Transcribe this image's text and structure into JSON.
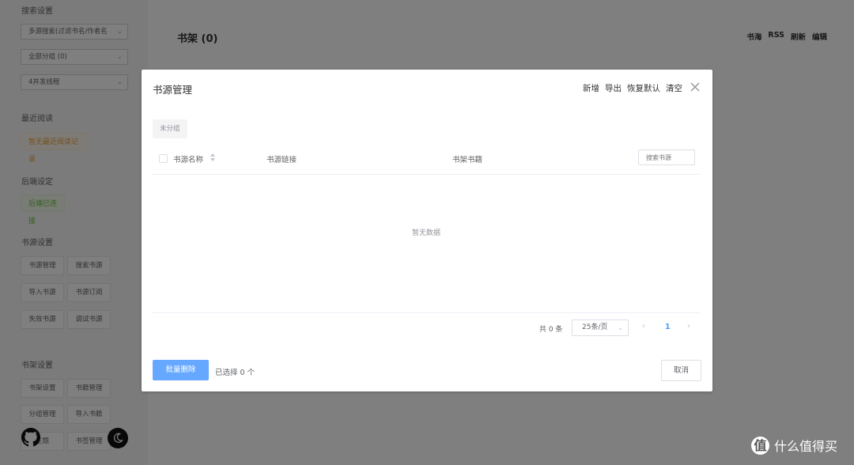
{
  "sidebar": {
    "search_section_title": "搜索设置",
    "search_select_value": "多源搜索(过滤书名/作者名",
    "group_select_value": "全部分组 (0)",
    "concurrency_select_value": "4并发线程",
    "recent_section_title": "最近阅读",
    "recent_tag": "暂无最近阅读记录",
    "backend_section_title": "后端设定",
    "backend_tag": "后端已连接",
    "source_section_title": "书源设置",
    "source_buttons": [
      "书源管理",
      "搜索书源",
      "导入书源",
      "书源订阅",
      "失效书源",
      "调试书源"
    ],
    "shelf_section_title": "书架设置",
    "shelf_buttons": [
      "书架设置",
      "书籍管理",
      "分组管理",
      "导入书籍",
      "主题",
      "书签管理"
    ]
  },
  "main": {
    "title": "书架 (0)",
    "top_links": [
      "书海",
      "RSS",
      "刷新",
      "编辑"
    ]
  },
  "dialog": {
    "title": "书源管理",
    "actions": [
      "新增",
      "导出",
      "恢复默认",
      "清空"
    ],
    "group_tab": "未分组",
    "columns": {
      "name": "书源名称",
      "url": "书源链接",
      "shelf": "书架书籍"
    },
    "search_placeholder": "搜索书源",
    "empty_text": "暂无数据",
    "pagination": {
      "total": "共 0 条",
      "page_size": "25条/页",
      "prev": "‹",
      "current": "1",
      "next": "›"
    },
    "batch_delete_label": "批量删除",
    "selected_text": "已选择 0 个",
    "cancel_label": "取消"
  },
  "watermark": {
    "badge": "值",
    "text": "什么值得买"
  }
}
